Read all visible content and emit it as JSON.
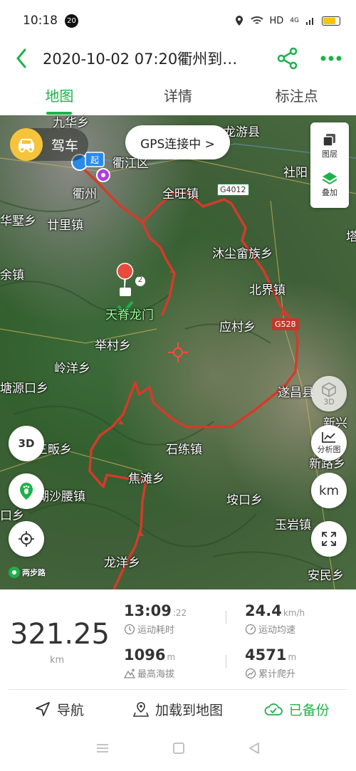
{
  "status": {
    "time": "10:18",
    "badge": "20",
    "network": "HD",
    "signal": "4G"
  },
  "header": {
    "title": "2020-10-02 07:20衢州到…"
  },
  "tabs": [
    {
      "label": "地图"
    },
    {
      "label": "详情"
    },
    {
      "label": "标注点"
    }
  ],
  "map": {
    "drive_label": "驾车",
    "gps_status": "GPS连接中 >",
    "layers_label": "图层",
    "overlay_label": "叠加",
    "btn_3d_label": "3D",
    "btn_analysis_label": "分析图",
    "btn_km_label": "km",
    "left_3d_label": "3D",
    "photo_count": "2",
    "logo_text": "两步路",
    "places": [
      {
        "id": "p1",
        "name": "九华乡"
      },
      {
        "id": "p2",
        "name": "龙游县"
      },
      {
        "id": "p3",
        "name": "衢江区"
      },
      {
        "id": "p4",
        "name": "衢州"
      },
      {
        "id": "p5",
        "name": "全旺镇"
      },
      {
        "id": "p6",
        "name": "社阳"
      },
      {
        "id": "p7",
        "name": "华墅乡"
      },
      {
        "id": "p8",
        "name": "廿里镇"
      },
      {
        "id": "p9",
        "name": "沐尘畲族乡"
      },
      {
        "id": "p10",
        "name": "塔"
      },
      {
        "id": "p11",
        "name": "余镇"
      },
      {
        "id": "p12",
        "name": "北界镇"
      },
      {
        "id": "p13",
        "name": "天脊龙门"
      },
      {
        "id": "p14",
        "name": "应村乡"
      },
      {
        "id": "p15",
        "name": "举村乡"
      },
      {
        "id": "p16",
        "name": "岭洋乡"
      },
      {
        "id": "p17",
        "name": "塘源口乡"
      },
      {
        "id": "p18",
        "name": "遂昌县"
      },
      {
        "id": "p19",
        "name": "新兴"
      },
      {
        "id": "p20",
        "name": "石练镇"
      },
      {
        "id": "p21",
        "name": "新路乡"
      },
      {
        "id": "p22",
        "name": "三畈乡"
      },
      {
        "id": "p23",
        "name": "焦滩乡"
      },
      {
        "id": "p24",
        "name": "湖沙腰镇"
      },
      {
        "id": "p25",
        "name": "垵口乡"
      },
      {
        "id": "p26",
        "name": "玉岩镇"
      },
      {
        "id": "p27",
        "name": "口乡"
      },
      {
        "id": "p28",
        "name": "龙洋乡"
      },
      {
        "id": "p29",
        "name": "安民乡"
      }
    ],
    "roads": [
      {
        "code": "G4012"
      },
      {
        "code": "G528"
      }
    ]
  },
  "stats": {
    "distance": "321.25",
    "distance_unit": "km",
    "duration_main": "13:09",
    "duration_sec": ":22",
    "duration_label": "运动耗时",
    "speed": "24.4",
    "speed_unit": "km/h",
    "speed_label": "运动均速",
    "max_alt": "1096",
    "max_alt_unit": "m",
    "max_alt_label": "最高海拔",
    "climb": "4571",
    "climb_unit": "m",
    "climb_label": "累计爬升"
  },
  "actions": {
    "navigate": "导航",
    "load_map": "加载到地图",
    "backed_up": "已备份"
  },
  "colors": {
    "accent": "#1db24a",
    "track": "#d63a2a"
  }
}
